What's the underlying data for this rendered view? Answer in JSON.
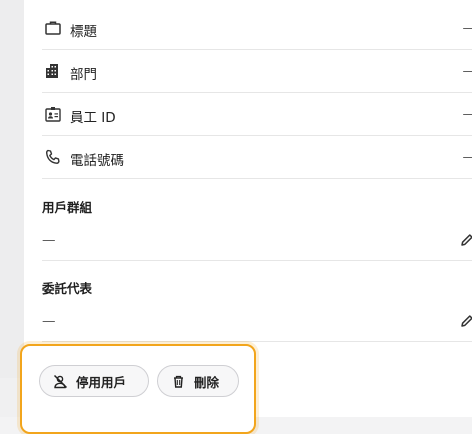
{
  "details": {
    "rows": [
      {
        "icon": "briefcase-icon",
        "label": "標題",
        "value": "—"
      },
      {
        "icon": "building-icon",
        "label": "部門",
        "value": "—"
      },
      {
        "icon": "id-badge-icon",
        "label": "員工 ID",
        "value": "—"
      },
      {
        "icon": "phone-icon",
        "label": "電話號碼",
        "value": "—"
      }
    ]
  },
  "user_groups": {
    "title": "用戶群組",
    "value": "—"
  },
  "delegates": {
    "title": "委託代表",
    "value": "—"
  },
  "actions": {
    "deactivate_label": "停用用戶",
    "delete_label": "刪除"
  },
  "colors": {
    "focus_outline": "#f2a51c"
  }
}
